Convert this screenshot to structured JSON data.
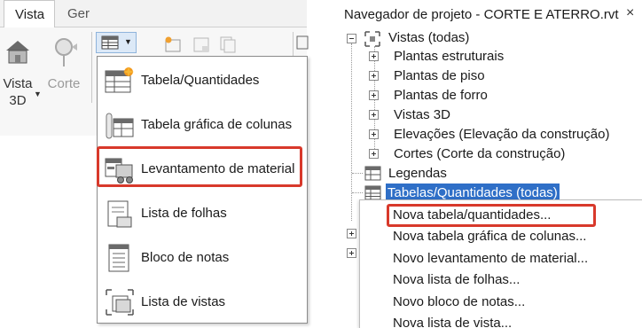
{
  "ribbon": {
    "tabs": [
      {
        "label": "Vista",
        "active": true
      },
      {
        "label": "Ger",
        "active": false
      }
    ],
    "buttons": {
      "vista3d_line1": "Vista",
      "vista3d_line2": "3D",
      "corte": "Corte"
    },
    "accent_color": "#dce9f7"
  },
  "menu": {
    "items": [
      {
        "label": "Tabela/Quantidades",
        "icon": "schedule-icon"
      },
      {
        "label": "Tabela gráfica de colunas",
        "icon": "graphical-column-schedule-icon"
      },
      {
        "label": "Levantamento de material",
        "icon": "material-takeoff-icon",
        "highlighted": true
      },
      {
        "label": "Lista de folhas",
        "icon": "sheet-list-icon"
      },
      {
        "label": "Bloco de notas",
        "icon": "note-block-icon"
      },
      {
        "label": "Lista de vistas",
        "icon": "view-list-icon"
      }
    ],
    "highlight_color": "#d8392b"
  },
  "browser": {
    "title": "Navegador de projeto - CORTE E ATERRO.rvt",
    "close_glyph": "×",
    "root": "Vistas (todas)",
    "children": [
      "Plantas estruturais",
      "Plantas de piso",
      "Plantas de forro",
      "Vistas 3D",
      "Elevações (Elevação da construção)",
      "Cortes (Corte da construção)"
    ],
    "legendas": "Legendas",
    "selected": "Tabelas/Quantidades (todas)",
    "selection_color": "#2f6fc7"
  },
  "context_menu": {
    "items": [
      {
        "label": "Nova tabela/quantidades...",
        "highlighted": true
      },
      {
        "label": "Nova tabela gráfica de colunas..."
      },
      {
        "label": "Novo levantamento de material..."
      },
      {
        "label": "Nova lista de folhas..."
      },
      {
        "label": "Novo bloco de notas..."
      },
      {
        "label": "Nova lista de vista..."
      }
    ]
  }
}
